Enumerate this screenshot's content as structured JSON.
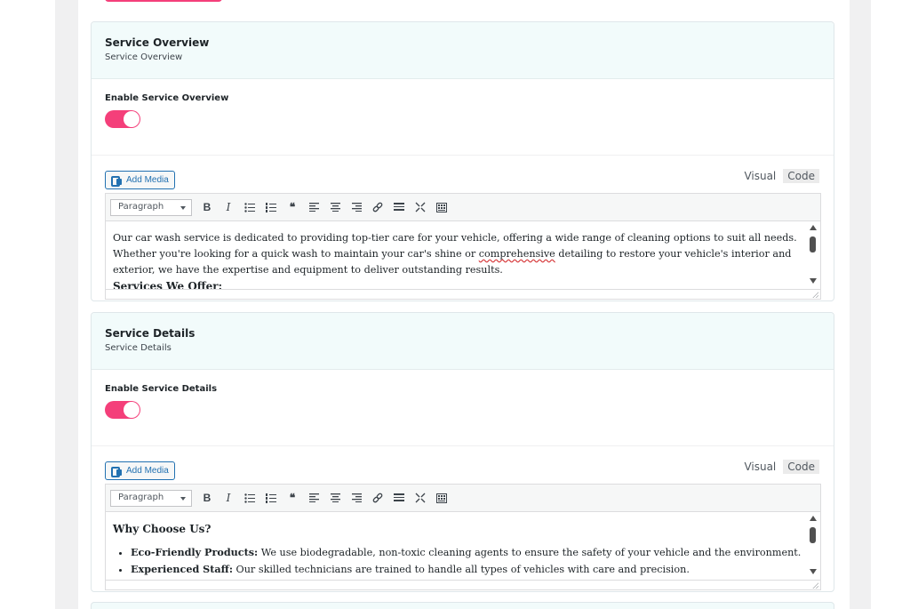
{
  "sections": [
    {
      "title": "Service Overview",
      "subtitle": "Service Overview",
      "toggle_label": "Enable Service Overview",
      "toggle_on": true,
      "editor": {
        "add_media_label": "Add Media",
        "tab_visual": "Visual",
        "tab_code": "Code",
        "format_value": "Paragraph",
        "content": {
          "para_before": "Our car wash service is dedicated to providing top-tier care for your vehicle, offering a wide range of cleaning options to suit all needs. Whether you're looking for a quick wash to maintain your car's shine or ",
          "misspelled_word": "comprehensive",
          "para_after": " detailing to restore your vehicle's interior and exterior, we have the expertise and equipment to deliver outstanding results.",
          "next_heading": "Services We Offer:"
        }
      }
    },
    {
      "title": "Service Details",
      "subtitle": "Service Details",
      "toggle_label": "Enable Service Details",
      "toggle_on": true,
      "editor": {
        "add_media_label": "Add Media",
        "tab_visual": "Visual",
        "tab_code": "Code",
        "format_value": "Paragraph",
        "content": {
          "heading": "Why Choose Us?",
          "items": [
            {
              "bold": "Eco-Friendly Products:",
              "text": " We use biodegradable, non-toxic cleaning agents to ensure the safety of your vehicle and the environment."
            },
            {
              "bold": "Experienced Staff:",
              "text": " Our skilled technicians are trained to handle all types of vehicles with care and precision."
            }
          ]
        }
      }
    }
  ],
  "toolbar_icons": [
    "bold-icon",
    "italic-icon",
    "bullet-list-icon",
    "numbered-list-icon",
    "blockquote-icon",
    "align-left-icon",
    "align-center-icon",
    "align-right-icon",
    "link-icon",
    "read-more-icon",
    "fullscreen-icon",
    "toolbar-toggle-icon"
  ],
  "colors": {
    "accent": "#f43f7a",
    "link": "#2271b1",
    "header_bg": "#f2fbfb"
  }
}
